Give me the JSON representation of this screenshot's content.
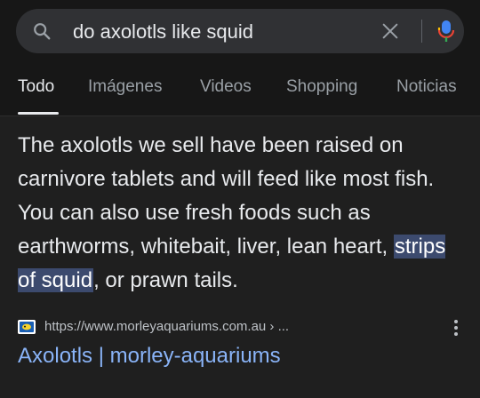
{
  "search": {
    "query": "do axolotls like squid",
    "search_icon": "search-icon",
    "clear_icon": "close-icon",
    "mic_icon": "microphone-icon"
  },
  "tabs": [
    {
      "label": "Todo",
      "active": true
    },
    {
      "label": "Imágenes",
      "active": false
    },
    {
      "label": "Videos",
      "active": false
    },
    {
      "label": "Shopping",
      "active": false
    },
    {
      "label": "Noticias",
      "active": false
    }
  ],
  "snippet": {
    "before": "The axolotls we sell have been raised on carnivore tablets and will feed like most fish. You can also use fresh foods such as earthworms, whitebait, liver, lean heart,",
    "highlight": "strips of squid",
    "after": ", or prawn tails."
  },
  "result": {
    "url": "https://www.morleyaquariums.com.au › ...",
    "title": "Axolotls | morley-aquariums",
    "more_icon": "more-vert-icon"
  },
  "colors": {
    "background": "#1f1f1f",
    "search_bar": "#303134",
    "link": "#8ab4f8",
    "highlight": "#3c4a6e",
    "mic_blue": "#4285f4",
    "mic_red": "#ea4335",
    "mic_yellow": "#fbbc04",
    "mic_green": "#34a853"
  }
}
